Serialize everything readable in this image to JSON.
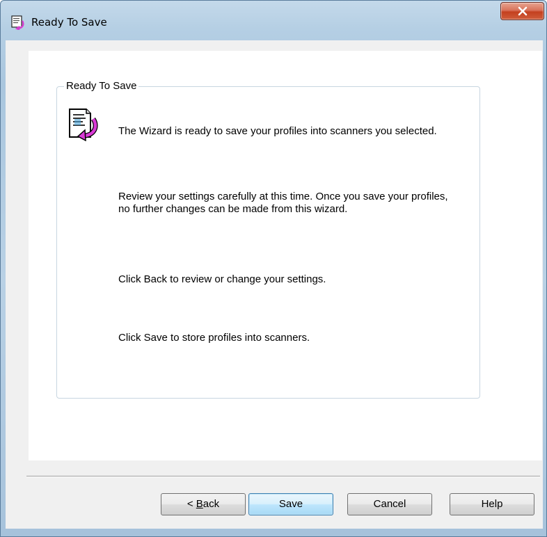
{
  "window": {
    "title": "Ready To Save"
  },
  "group": {
    "title": "Ready To Save"
  },
  "body": {
    "paragraphs": [
      "The Wizard is ready to save your profiles into scanners you selected.",
      "Review your settings carefully at this time. Once you save your profiles, no further changes can be made from this wizard.",
      "Click Back to review or change your settings.",
      "Click Save to store profiles into scanners."
    ]
  },
  "buttons": {
    "back_prefix": "< ",
    "back_mnemonic": "B",
    "back_rest": "ack",
    "save": "Save",
    "cancel": "Cancel",
    "help": "Help"
  },
  "icons": {
    "title_icon": "wizard-document-icon",
    "wizard_icon": "document-arrow-icon",
    "close_icon": "close-icon"
  },
  "colors": {
    "close_button": "#c4401f",
    "group_border": "#c7d5e0",
    "default_button_border": "#3c7fb1"
  }
}
